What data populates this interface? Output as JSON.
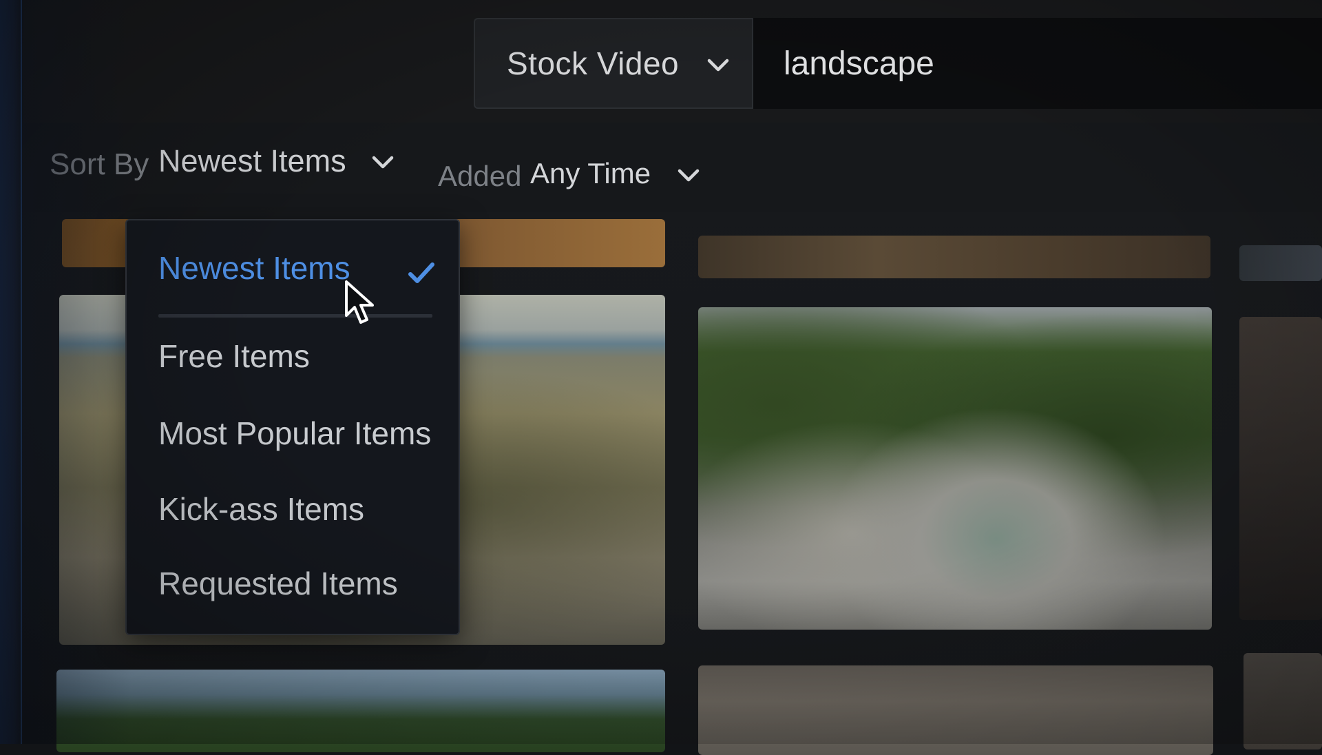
{
  "search": {
    "type_label": "Stock Video",
    "query": "landscape"
  },
  "filters": {
    "sort_by_label": "Sort By",
    "sort_by_value": "Newest Items",
    "added_label": "Added",
    "added_value": "Any Time"
  },
  "sort_menu": {
    "items": [
      {
        "label": "Newest Items",
        "selected": true
      },
      {
        "label": "Free Items",
        "selected": false
      },
      {
        "label": "Most Popular Items",
        "selected": false
      },
      {
        "label": "Kick-ass Items",
        "selected": false
      },
      {
        "label": "Requested Items",
        "selected": false
      }
    ]
  },
  "icons": {
    "chevron": "chevron-down-icon",
    "check": "checkmark-icon",
    "cursor": "mouse-pointer-icon"
  },
  "colors": {
    "accent": "#4e8fe4",
    "menu_bg": "#14171d",
    "page_bg": "#121417"
  }
}
